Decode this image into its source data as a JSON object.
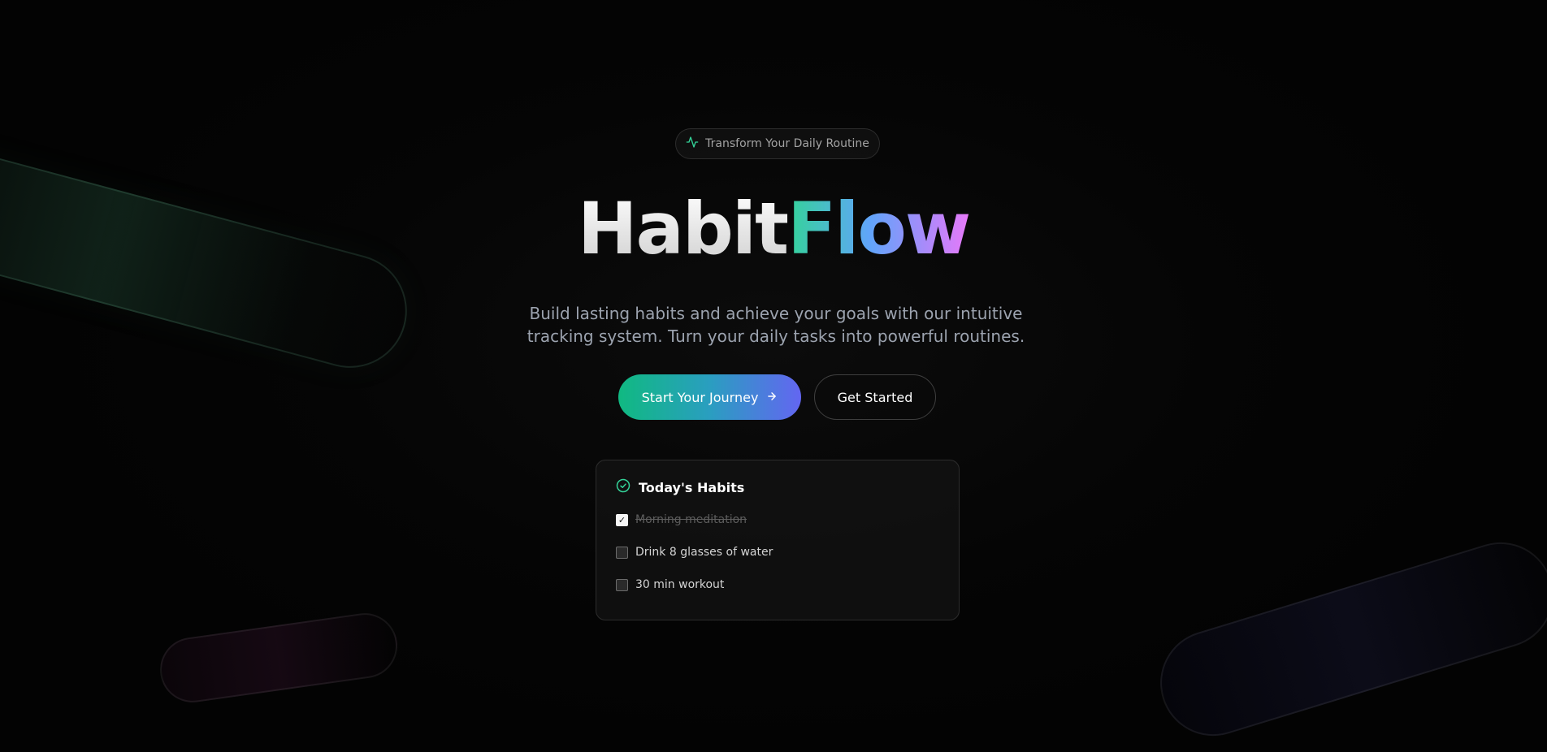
{
  "badge": {
    "icon": "activity-icon",
    "text": "Transform Your Daily Routine"
  },
  "hero": {
    "title_part1": "Habit",
    "title_part2": "Flow",
    "subtitle": "Build lasting habits and achieve your goals with our intuitive tracking system. Turn your daily tasks into powerful routines."
  },
  "actions": {
    "primary_label": "Start Your Journey",
    "primary_icon": "arrow-right-icon",
    "secondary_label": "Get Started"
  },
  "habits_card": {
    "title": "Today's Habits",
    "icon": "check-circle-icon",
    "items": [
      {
        "label": "Morning meditation",
        "checked": true
      },
      {
        "label": "Drink 8 glasses of water",
        "checked": false
      },
      {
        "label": "30 min workout",
        "checked": false
      }
    ]
  },
  "colors": {
    "background": "#030303",
    "accent_green": "#10b981",
    "accent_indigo": "#6366f1",
    "gradient_pink": "#e879f9"
  }
}
